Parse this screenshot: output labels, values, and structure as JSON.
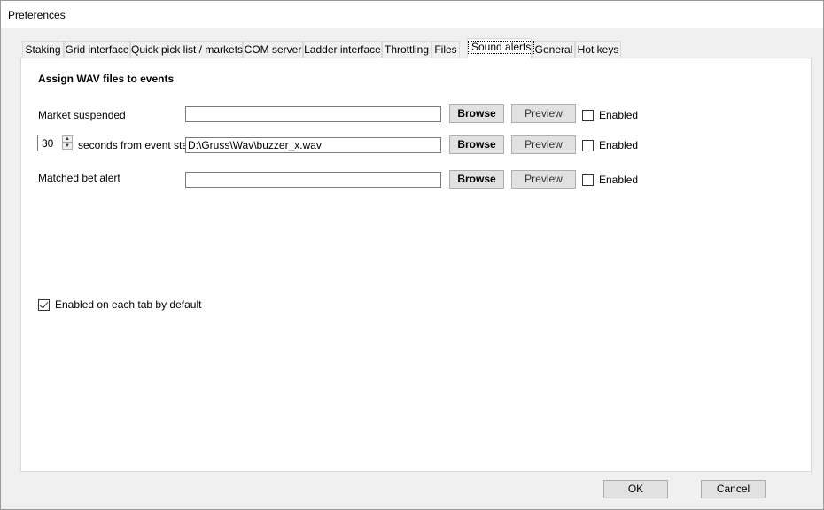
{
  "window": {
    "title": "Preferences"
  },
  "tabs": [
    {
      "label": "Staking"
    },
    {
      "label": "Grid interface"
    },
    {
      "label": "Quick pick list / markets"
    },
    {
      "label": "COM server"
    },
    {
      "label": "Ladder interface"
    },
    {
      "label": "Throttling"
    },
    {
      "label": "Files"
    },
    {
      "label": "Sound alerts",
      "active": true
    },
    {
      "label": "General"
    },
    {
      "label": "Hot keys"
    }
  ],
  "panel": {
    "heading": "Assign WAV files to events",
    "rows": [
      {
        "label": "Market suspended",
        "path": "",
        "browse": "Browse",
        "preview": "Preview",
        "enabled_label": "Enabled",
        "enabled": false
      },
      {
        "spin_value": "30",
        "label": "seconds from event start",
        "path": "D:\\Gruss\\Wav\\buzzer_x.wav",
        "browse": "Browse",
        "preview": "Preview",
        "enabled_label": "Enabled",
        "enabled": false
      },
      {
        "label": "Matched bet alert",
        "path": "",
        "browse": "Browse",
        "preview": "Preview",
        "enabled_label": "Enabled",
        "enabled": false
      }
    ],
    "default_checkbox": {
      "label": "Enabled on each tab by default",
      "checked": true
    }
  },
  "footer": {
    "ok": "OK",
    "cancel": "Cancel"
  }
}
